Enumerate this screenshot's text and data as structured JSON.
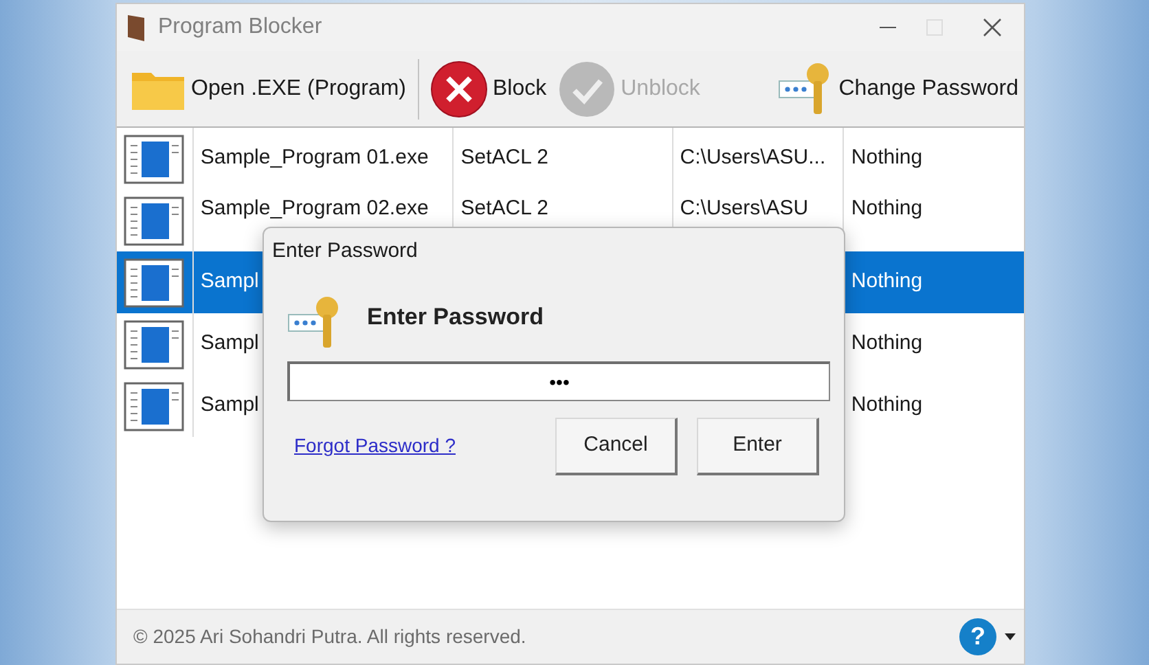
{
  "window": {
    "title": "Program Blocker",
    "maximize_disabled": true
  },
  "toolbar": [
    {
      "kind": "open",
      "label": "Open .EXE (Program)",
      "disabled": false
    },
    {
      "kind": "block",
      "label": "Block",
      "disabled": false
    },
    {
      "kind": "unblock",
      "label": "Unblock",
      "disabled": true
    },
    {
      "kind": "password",
      "label": "Change Password",
      "disabled": false
    }
  ],
  "list": {
    "rows": [
      {
        "column_1": "Sample_Program 01.exe",
        "column_2": "SetACL 2",
        "column_3": "C:\\Users\\ASU...",
        "column_4": "Nothing",
        "selected": false
      },
      {
        "column_1": "Sample_Program 02.exe",
        "column_2": "SetACL 2",
        "column_3": "C:\\Users\\ASU",
        "column_4": "Nothing",
        "selected": false
      },
      {
        "column_1": "Sampl",
        "column_4": "Nothing",
        "selected": true
      },
      {
        "column_1": "Sampl",
        "column_4": "Nothing",
        "selected": false
      },
      {
        "column_1": "Sampl",
        "column_4": "Nothing",
        "selected": false
      }
    ]
  },
  "dialog": {
    "title": "Enter Password",
    "heading": "Enter Password",
    "password": "•••",
    "link": "Forgot Password ?",
    "buttons": [
      "Cancel",
      "Enter"
    ]
  },
  "status_bar": {
    "text": "© 2025 Ari Sohandri Putra. All rights reserved.",
    "help": "?"
  }
}
